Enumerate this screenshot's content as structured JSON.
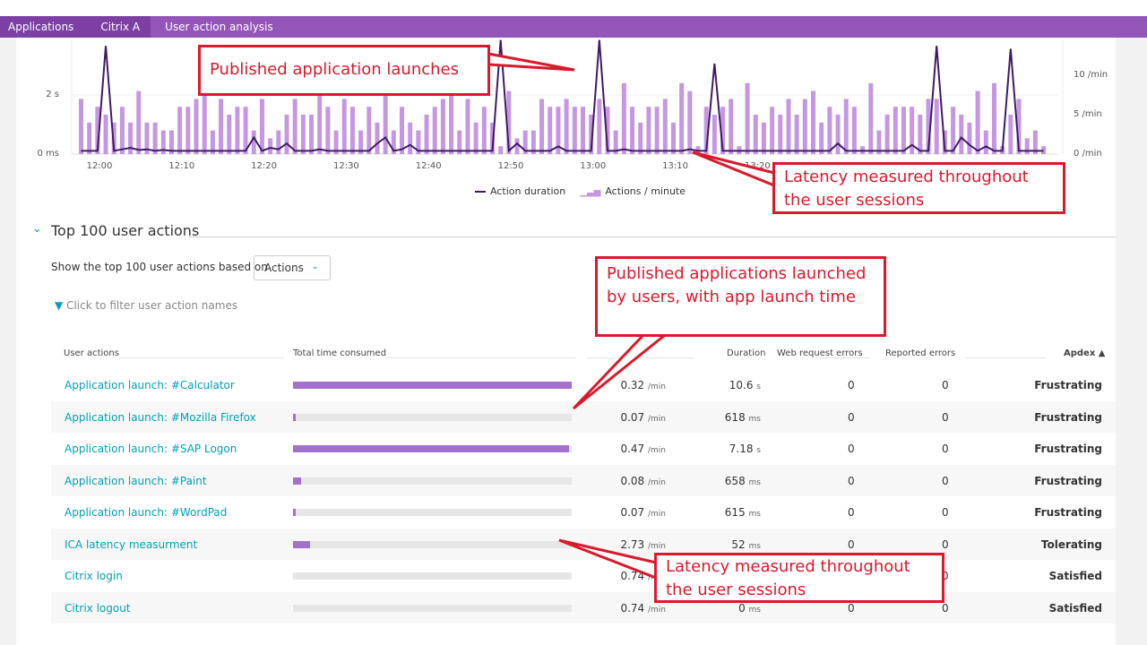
{
  "breadcrumb": [
    "Applications",
    "Citrix A",
    "User action analysis"
  ],
  "chart_data": {
    "type": "bar+line",
    "x_start": "11:57",
    "x_step_minutes": 1,
    "xticks": [
      "12:00",
      "12:10",
      "12:20",
      "12:30",
      "12:40",
      "12:50",
      "13:00",
      "13:10",
      "13:20"
    ],
    "y_left_ticks": [
      "0 ms",
      "2 s"
    ],
    "y_right_ticks": [
      "0 /min",
      "5 /min",
      "10 /min"
    ],
    "series": [
      {
        "name": "Actions / minute",
        "type": "bar",
        "axis": "right",
        "color": "#c597e3",
        "values": [
          7,
          4,
          6,
          5,
          4,
          6,
          4,
          8,
          4,
          4,
          3,
          3,
          6,
          6,
          7,
          8,
          3,
          7,
          5,
          6,
          6,
          3,
          7,
          2,
          3,
          5,
          7,
          5,
          5,
          8,
          6,
          3,
          7,
          6,
          3,
          6,
          4,
          8,
          3,
          6,
          4,
          3,
          5,
          6,
          7,
          8,
          3,
          7,
          4,
          6,
          4,
          1,
          8,
          2,
          3,
          3,
          7,
          6,
          6,
          7,
          6,
          6,
          5,
          7,
          6,
          3,
          9,
          6,
          4,
          6,
          6,
          7,
          4,
          9,
          8,
          1,
          6,
          5,
          6,
          7,
          1,
          9,
          5,
          4,
          6,
          5,
          7,
          5,
          7,
          8,
          4,
          6,
          5,
          7,
          6,
          1,
          9,
          3,
          5,
          6,
          6,
          6,
          5,
          7,
          7,
          3,
          6,
          5,
          4,
          8,
          3,
          9,
          1,
          5,
          7,
          2,
          3,
          1
        ]
      },
      {
        "name": "Action duration",
        "type": "line",
        "axis": "left",
        "unit": "s",
        "color": "#3f1a63",
        "values": [
          0.05,
          0.05,
          0.05,
          3.6,
          0.05,
          0.1,
          0.15,
          0.08,
          0.1,
          0.05,
          0.08,
          0.05,
          0.05,
          0.05,
          0.05,
          0.05,
          0.05,
          0.05,
          0.05,
          0.05,
          0.05,
          0.5,
          0.05,
          0.15,
          0.1,
          0.3,
          0.05,
          0.05,
          0.05,
          0.1,
          0.05,
          0.05,
          0.05,
          0.05,
          0.05,
          0.05,
          0.3,
          0.5,
          0.05,
          0.1,
          0.25,
          0.05,
          0.05,
          0.05,
          0.05,
          0.05,
          0.05,
          0.05,
          0.05,
          0.05,
          0.05,
          3.8,
          0.05,
          0.3,
          0.05,
          0.05,
          0.05,
          0.05,
          0.2,
          0.05,
          0.05,
          0.05,
          0.05,
          3.8,
          0.05,
          0.05,
          0.1,
          0.05,
          0.05,
          0.05,
          0.05,
          0.05,
          0.05,
          0.05,
          0.1,
          0.05,
          0.05,
          3.0,
          0.05,
          0.05,
          0.05,
          0.05,
          0.05,
          0.05,
          0.05,
          0.05,
          0.05,
          0.05,
          0.05,
          0.05,
          0.05,
          0.05,
          0.3,
          0.05,
          0.05,
          0.05,
          0.05,
          0.05,
          0.05,
          0.05,
          0.05,
          0.25,
          0.05,
          0.05,
          3.6,
          0.05,
          0.05,
          0.5,
          0.25,
          0.05,
          0.2,
          0.05,
          0.05,
          3.5,
          0.05,
          0.05,
          0.05,
          0.05
        ]
      }
    ],
    "left_max_s": 4,
    "right_max_per_min": 14
  },
  "legend": {
    "line": "Action duration",
    "bars": "Actions / minute"
  },
  "section": {
    "title": "Top 100 user actions",
    "show_label": "Show the top 100 user actions based on",
    "select_value": "Actions",
    "filter_placeholder": "Click to filter user action names"
  },
  "table": {
    "headers": {
      "name": "User actions",
      "total": "Total time consumed",
      "duration": "Duration",
      "web_errors": "Web request errors",
      "reported_errors": "Reported errors",
      "apdex": "Apdex ▲"
    },
    "rows": [
      {
        "name": "Application launch: #Calculator",
        "total_fraction": 1.0,
        "apm": "0.32",
        "apm_unit": "/min",
        "dur": "10.6",
        "dur_unit": "s",
        "web": "0",
        "rep": "0",
        "apdex": "Frustrating"
      },
      {
        "name": "Application launch: #Mozilla Firefox",
        "total_fraction": 0.01,
        "apm": "0.07",
        "apm_unit": "/min",
        "dur": "618",
        "dur_unit": "ms",
        "web": "0",
        "rep": "0",
        "apdex": "Frustrating"
      },
      {
        "name": "Application launch: #SAP Logon",
        "total_fraction": 0.99,
        "apm": "0.47",
        "apm_unit": "/min",
        "dur": "7.18",
        "dur_unit": "s",
        "web": "0",
        "rep": "0",
        "apdex": "Frustrating"
      },
      {
        "name": "Application launch: #Paint",
        "total_fraction": 0.03,
        "apm": "0.08",
        "apm_unit": "/min",
        "dur": "658",
        "dur_unit": "ms",
        "web": "0",
        "rep": "0",
        "apdex": "Frustrating"
      },
      {
        "name": "Application launch: #WordPad",
        "total_fraction": 0.01,
        "apm": "0.07",
        "apm_unit": "/min",
        "dur": "615",
        "dur_unit": "ms",
        "web": "0",
        "rep": "0",
        "apdex": "Frustrating"
      },
      {
        "name": "ICA latency measurment",
        "total_fraction": 0.06,
        "apm": "2.73",
        "apm_unit": "/min",
        "dur": "52",
        "dur_unit": "ms",
        "web": "0",
        "rep": "0",
        "apdex": "Tolerating"
      },
      {
        "name": "Citrix login",
        "total_fraction": 0.0,
        "apm": "0.74",
        "apm_unit": "/min",
        "dur": "",
        "dur_unit": "",
        "web": "",
        "rep": "0",
        "apdex": "Satisfied"
      },
      {
        "name": "Citrix logout",
        "total_fraction": 0.0,
        "apm": "0.74",
        "apm_unit": "/min",
        "dur": "0",
        "dur_unit": "ms",
        "web": "0",
        "rep": "0",
        "apdex": "Satisfied"
      }
    ]
  },
  "callouts": [
    "Published application launches",
    "Latency measured throughout the user sessions",
    "Published applications launched by users, with app launch time",
    "Latency measured throughout the user sessions"
  ]
}
